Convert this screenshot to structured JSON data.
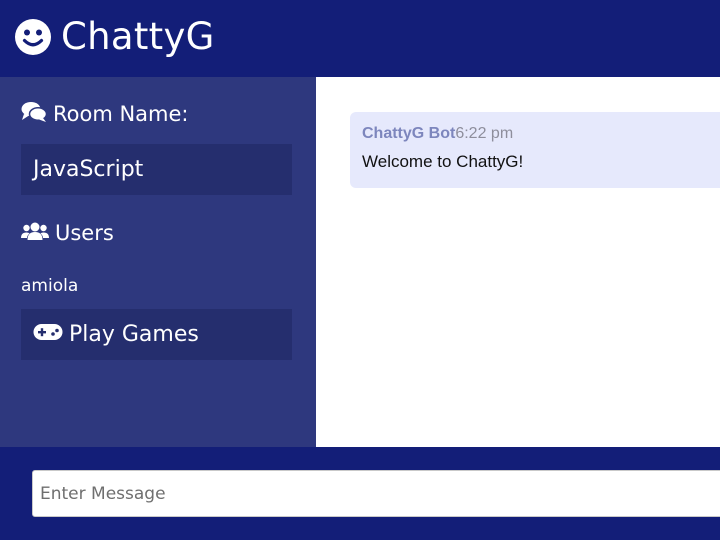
{
  "header": {
    "title": "ChattyG",
    "logo_icon": "smile-icon"
  },
  "sidebar": {
    "room_heading": "Room Name:",
    "room_icon": "comments-icon",
    "room_name": "JavaScript",
    "users_heading": "Users",
    "users_icon": "users-icon",
    "users": [
      "amiola"
    ],
    "games_button": "Play Games",
    "games_icon": "gamepad-icon"
  },
  "chat": {
    "messages": [
      {
        "user": "ChattyG Bot",
        "time": "6:22 pm",
        "text": "Welcome to ChattyG!"
      }
    ]
  },
  "form": {
    "message_placeholder": "Enter Message",
    "message_value": ""
  },
  "colors": {
    "header_bg": "#131e78",
    "sidebar_bg": "#2e387e",
    "box_bg": "#252e6e",
    "message_bg": "#e6e9fc",
    "username_color": "#7d86bd"
  }
}
